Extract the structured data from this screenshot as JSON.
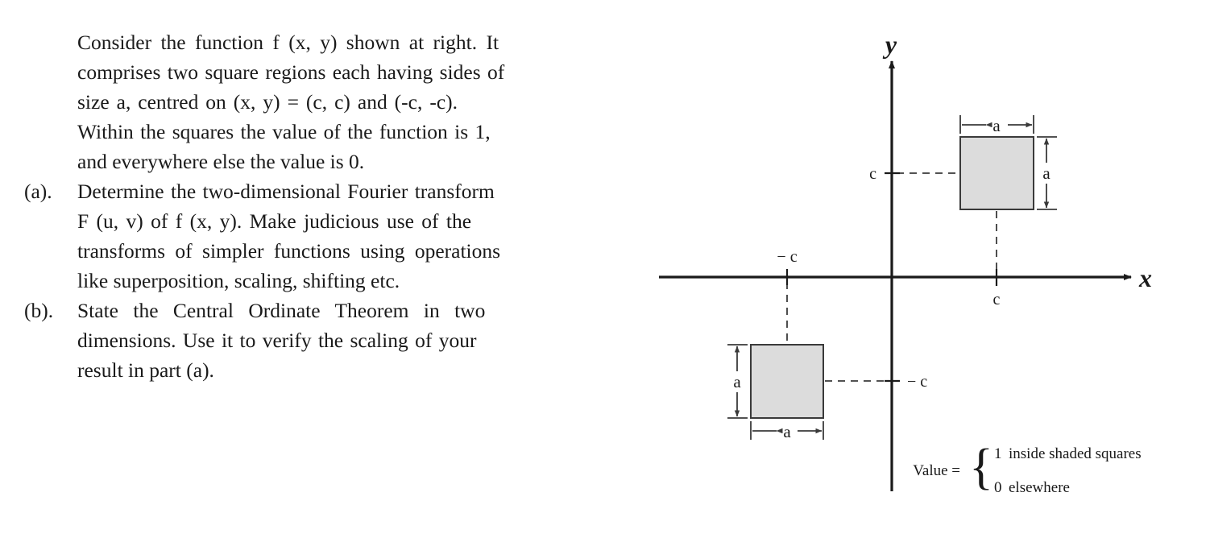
{
  "question": {
    "intro": {
      "marker": "",
      "lines": [
        "Consider the function  f (x, y)  shown at right.   It",
        "comprises two square regions each having sides of",
        "size  a, centred on  (x, y) = (c, c)  and  (-c, -c).",
        "Within the squares the value of the function is 1,",
        "and everywhere else the value is 0."
      ]
    },
    "parts": [
      {
        "marker": "(a).",
        "lines": [
          "Determine the two-dimensional Fourier transform",
          "F (u, v)  of  f (x, y).   Make judicious use of the",
          "transforms of simpler functions using operations",
          "like superposition, scaling, shifting etc."
        ]
      },
      {
        "marker": "(b).",
        "lines": [
          "State the Central Ordinate Theorem in two",
          "dimensions.   Use it to verify the scaling of your",
          "result in part (a)."
        ]
      }
    ]
  },
  "diagram": {
    "axis_labels": {
      "x": "x",
      "y": "y"
    },
    "ticks": {
      "x_positive": "c",
      "x_negative": "− c",
      "y_positive": "c",
      "y_negative": "− c"
    },
    "squares": [
      {
        "name": "upper-right-square",
        "center": "(c, c)",
        "width_label": "a",
        "height_label": "a",
        "fill": "#dcdcdc",
        "stroke": "#3a3a3a"
      },
      {
        "name": "lower-left-square",
        "center": "(-c, -c)",
        "width_label": "a",
        "height_label": "a",
        "fill": "#dcdcdc",
        "stroke": "#3a3a3a"
      }
    ],
    "legend": {
      "label": "Value  =",
      "brace": "{",
      "case_top_value": "1",
      "case_top_text": "inside shaded squares",
      "case_bottom_value": "0",
      "case_bottom_text": "elsewhere"
    }
  }
}
